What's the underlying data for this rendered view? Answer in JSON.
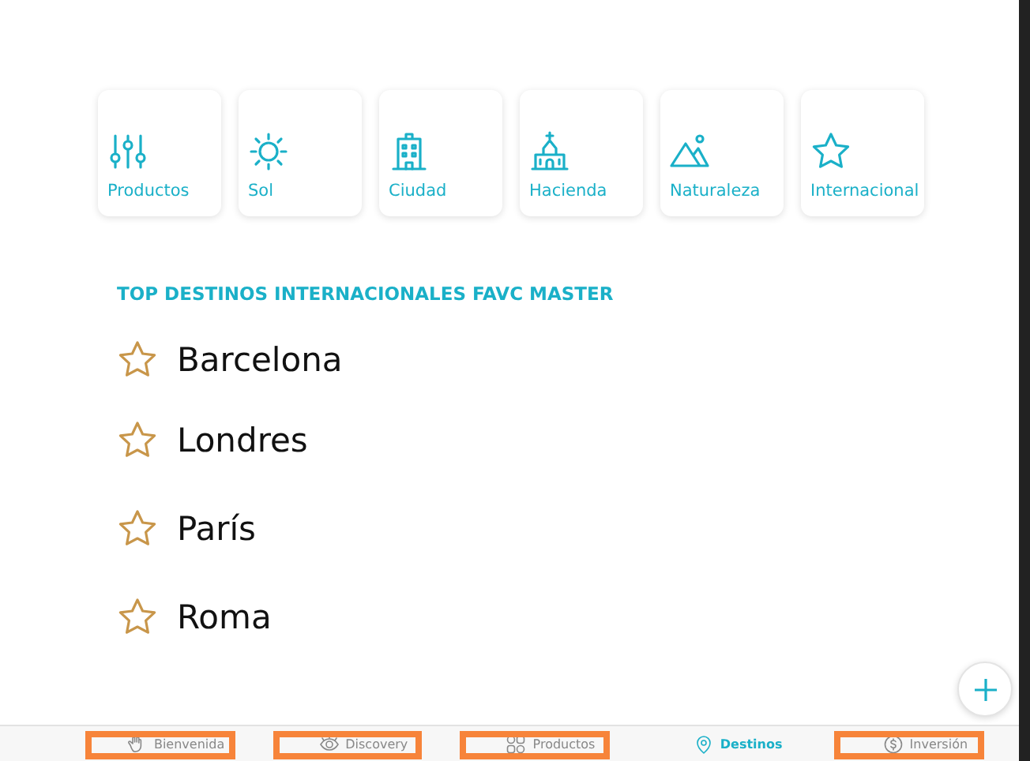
{
  "categories": [
    {
      "kind": "sliders",
      "label": "Productos"
    },
    {
      "kind": "sun",
      "label": "Sol"
    },
    {
      "kind": "building",
      "label": "Ciudad"
    },
    {
      "kind": "church",
      "label": "Hacienda"
    },
    {
      "kind": "mountains",
      "label": "Naturaleza"
    },
    {
      "kind": "star",
      "label": "Internacional"
    }
  ],
  "section_title": "TOP DESTINOS INTERNACIONALES FAVC MASTER",
  "destinations": [
    {
      "name": "Barcelona"
    },
    {
      "name": "Londres"
    },
    {
      "name": "París"
    },
    {
      "name": "Roma"
    }
  ],
  "tab_bar": [
    {
      "kind": "hand",
      "label": "Bienvenida",
      "selected": false,
      "highlighted": true
    },
    {
      "kind": "eye",
      "label": "Discovery",
      "selected": false,
      "highlighted": true
    },
    {
      "kind": "grid",
      "label": "Productos",
      "selected": false,
      "highlighted": true
    },
    {
      "kind": "pin",
      "label": "Destinos",
      "selected": true,
      "highlighted": false
    },
    {
      "kind": "coin",
      "label": "Inversión",
      "selected": false,
      "highlighted": true
    }
  ]
}
